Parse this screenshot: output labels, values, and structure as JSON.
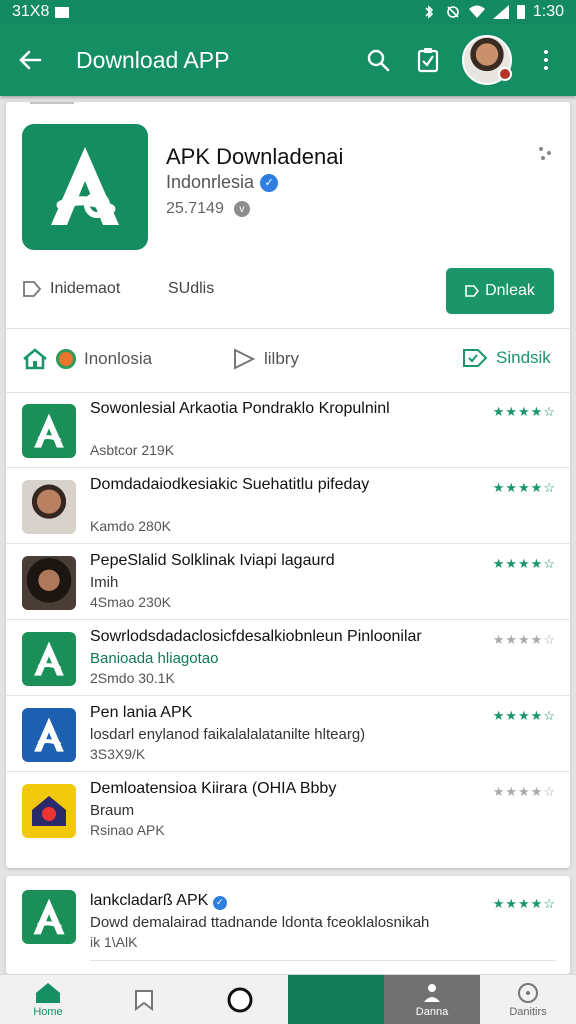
{
  "status_bar": {
    "time_left": "31X8",
    "time_right": "1:30"
  },
  "app_bar": {
    "title": "Download APP"
  },
  "app": {
    "name": "APK Downladenai",
    "developer": "Indonrlesia",
    "size": "25.7149",
    "tag_left": "Inidemaot",
    "tag_mid": "SUdlis",
    "download_label": "Dnleak"
  },
  "filters": {
    "home": "Inonlosia",
    "library": "lilbry",
    "sort": "Sindsik"
  },
  "list": [
    {
      "title": "Sowonlesial Arkaotia Pondraklo Kropulninl",
      "sub": "",
      "meta": "Asbtcor  219K",
      "stars": "★★★★☆",
      "thumb": "green",
      "dim": false
    },
    {
      "title": "Domdadaiodkesiakic Suehatitlu pifeday",
      "sub": "",
      "meta": "Kamdo  280K",
      "stars": "★★★★☆",
      "thumb": "photo1",
      "dim": false
    },
    {
      "title": "PepeSlalid Solklinak Iviapi lagaurd",
      "sub": "Imih",
      "meta": "4Smao  230K",
      "stars": "★★★★☆",
      "thumb": "photo2",
      "dim": false
    },
    {
      "title": "Sowrlodsdadaclosicfdesalkiobnleun Pinloonilar",
      "sub": "Banioada hliagotao",
      "meta": "2Smdo  30.1K",
      "stars": "★★★★☆",
      "thumb": "green",
      "dim": true,
      "sub_green": true
    },
    {
      "title": "Pen lania APK",
      "sub": "losdarl enylanod faikalalalatanilte hltearg)",
      "meta": "3S3X9/K",
      "stars": "★★★★☆",
      "thumb": "blue",
      "dim": false
    },
    {
      "title": "Demloatensioa Kiirara (OHIA Bbby",
      "sub": "Braum",
      "meta": "Rsinao  APK",
      "stars": "★★★★☆",
      "thumb": "yellow",
      "dim": true
    }
  ],
  "card2": {
    "title": "lankcladarß APK",
    "sub": "Dowd demalairad ttadnande ldonta fceoklalosnikah",
    "meta": "ik  1\\AlK",
    "stars": "★★★★☆"
  },
  "bottom_nav": [
    {
      "label": "Home"
    },
    {
      "label": ""
    },
    {
      "label": ""
    },
    {
      "label": ""
    },
    {
      "label": "Danna"
    },
    {
      "label": "Danitirs"
    }
  ],
  "colors": {
    "primary": "#168e63",
    "accent_star": "#1a9668"
  }
}
